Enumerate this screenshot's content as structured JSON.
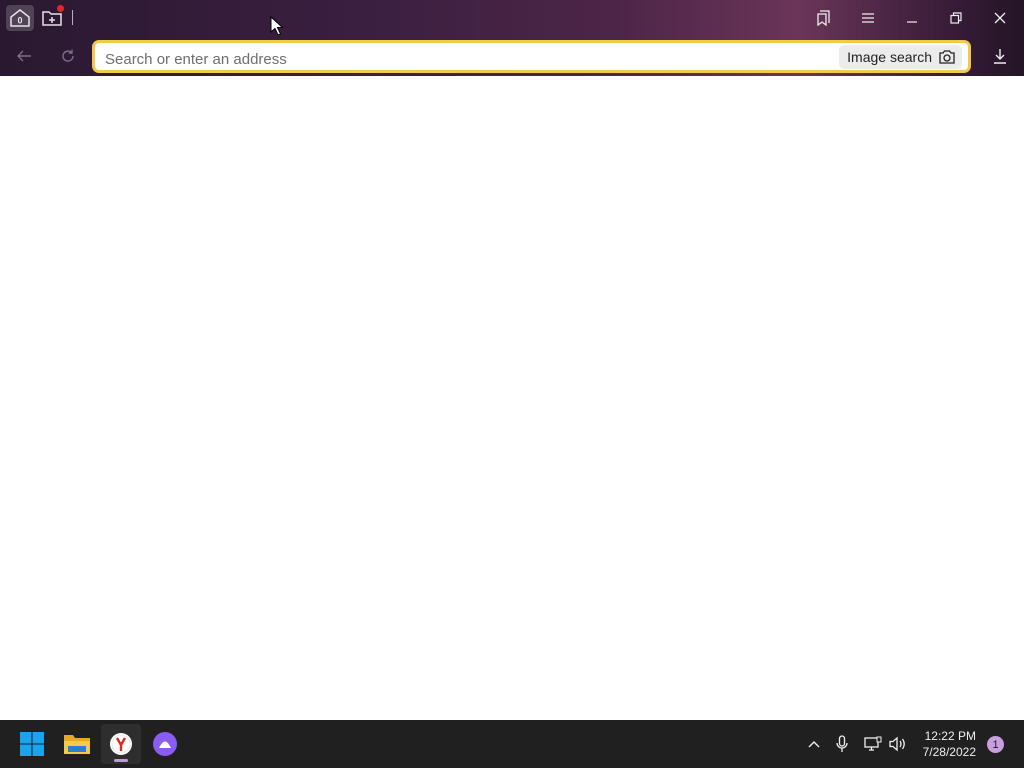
{
  "titlebar": {
    "tab_count": "0",
    "buttons": [
      "tab-home-button",
      "new-tab-button"
    ],
    "window_controls": [
      "collections-icon",
      "menu-icon",
      "minimize-icon",
      "restore-icon",
      "close-icon"
    ]
  },
  "navbar": {
    "back_icon": "back-arrow-icon",
    "reload_icon": "reload-icon",
    "search": {
      "placeholder": "Search or enter an address",
      "value": ""
    },
    "image_search_label": "Image search",
    "download_icon": "download-icon"
  },
  "colors": {
    "accent": "#f2c94c",
    "taskbar": "#202020",
    "notification_badge": "#c79fde",
    "new_tab_dot": "#e2262d"
  },
  "taskbar": {
    "apps": [
      "start-icon",
      "file-explorer-icon",
      "yandex-browser-icon",
      "alice-assistant-icon"
    ],
    "tray": [
      "chevron-up-icon",
      "microphone-icon",
      "network-icon",
      "volume-icon"
    ],
    "time": "12:22 PM",
    "date": "7/28/2022",
    "notification_count": "1"
  }
}
